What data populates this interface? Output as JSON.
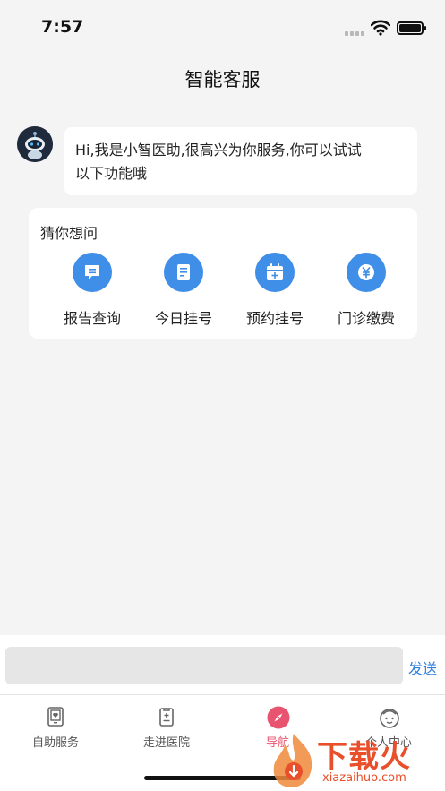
{
  "status_bar": {
    "time": "7:57"
  },
  "header": {
    "title": "智能客服"
  },
  "chat": {
    "greeting_line1": "Hi,我是小智医助,很高兴为你服务,你可以试试",
    "greeting_line2": "以下功能哦"
  },
  "guess": {
    "title": "猜你想问",
    "items": [
      {
        "label": "报告查询",
        "icon": "message-icon"
      },
      {
        "label": "今日挂号",
        "icon": "document-icon"
      },
      {
        "label": "预约挂号",
        "icon": "calendar-plus-icon"
      },
      {
        "label": "门诊缴费",
        "icon": "yuan-icon"
      }
    ]
  },
  "composer": {
    "input_value": "",
    "send_label": "发送"
  },
  "tabs": [
    {
      "label": "自助服务",
      "icon": "tablet-icon"
    },
    {
      "label": "走进医院",
      "icon": "clipboard-plus-icon"
    },
    {
      "label": "导航",
      "icon": "compass-icon"
    },
    {
      "label": "个人中心",
      "icon": "face-icon"
    }
  ],
  "colors": {
    "accent": "#3f8ee8",
    "active_tab": "#e8546f",
    "send": "#2f7fe0"
  },
  "watermark": {
    "brand": "下载火",
    "url": "xiazaihuo.com"
  }
}
